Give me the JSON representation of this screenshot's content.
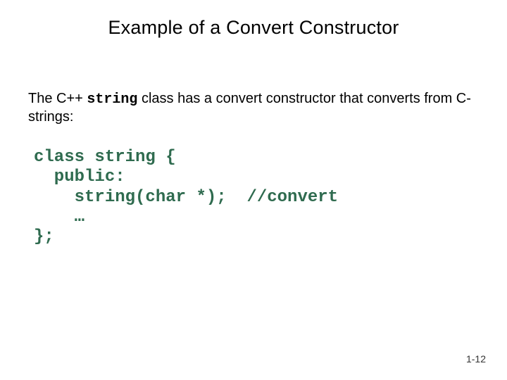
{
  "title": "Example of a Convert Constructor",
  "paragraph": {
    "pre": "The C++ ",
    "keyword": "string",
    "post": " class has a convert constructor that converts from C-strings:"
  },
  "code": {
    "l1": "class string {",
    "l2": "  public:",
    "l3": "    string(char *);  //convert",
    "l4": "    …",
    "l5": "};"
  },
  "page_number": "1-12"
}
